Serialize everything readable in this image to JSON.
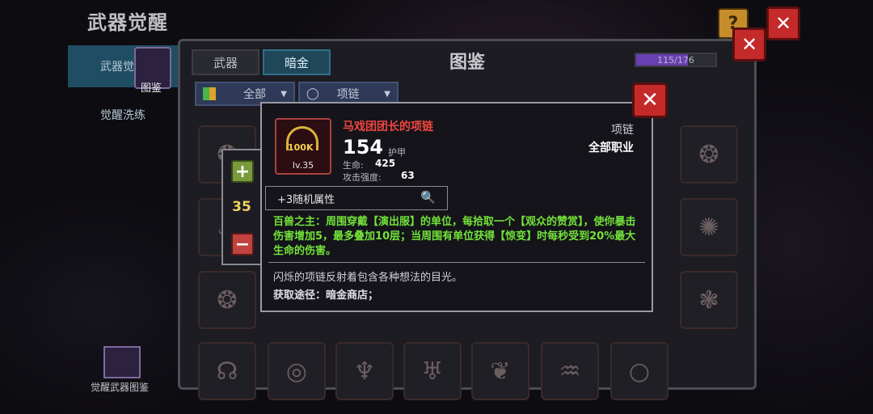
{
  "page": {
    "title": "武器觉醒"
  },
  "left_nav": {
    "items": [
      {
        "label": "武器觉"
      },
      {
        "label": "觉醒洗练"
      }
    ],
    "codex_thumb_label": "图鉴",
    "bottom_codex_label": "觉醒武器图鉴"
  },
  "top_buttons": {
    "help_label": "?",
    "close_label": "✕"
  },
  "codex": {
    "title": "图鉴",
    "tabs": [
      {
        "label": "武器"
      },
      {
        "label": "暗金"
      }
    ],
    "active_tab": "暗金",
    "progress_text": "115/176",
    "progress_value": 0.65,
    "filters": [
      {
        "label": "全部"
      },
      {
        "label": "项链"
      }
    ],
    "close_label": "✕"
  },
  "level_control": {
    "plus": "+",
    "value": "35",
    "minus": "−"
  },
  "item": {
    "name": "马戏团团长的项链",
    "icon_badge": "100K",
    "level": "lv.35",
    "power": "154",
    "power_label": "护甲",
    "stats": [
      {
        "label": "生命:",
        "value": "425"
      },
      {
        "label": "攻击强度:",
        "value": "63"
      }
    ],
    "type": "项链",
    "class": "全部职业",
    "random_attr": "+3随机属性",
    "skill": "百兽之主：周围穿戴【演出服】的单位，每拾取一个【观众的赞赏】，使你暴击伤害增加5，最多叠加10层；当周围有单位获得【惊变】时每秒受到20%最大生命的伤害。",
    "flavor": "闪烁的项链反射着包含各种想法的目光。",
    "source": "获取途径：暗金商店；",
    "close_label": "✕"
  },
  "colors": {
    "item_name": "#f2453e",
    "skill_text": "#73e23a",
    "level_value": "#f0d45a",
    "progress_fill": "#6a3fb3"
  }
}
